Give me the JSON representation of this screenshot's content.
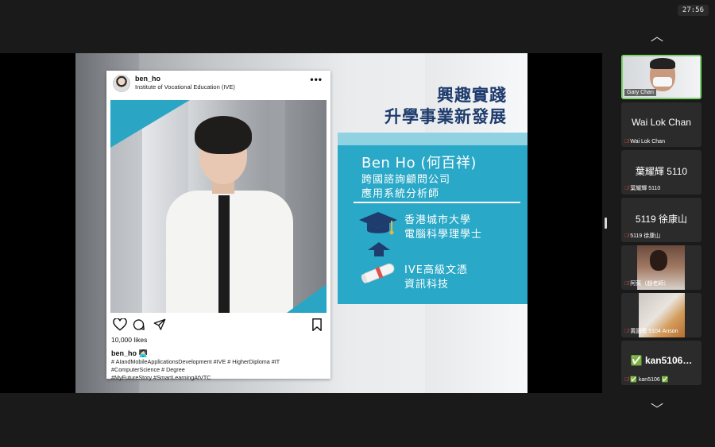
{
  "meeting": {
    "timer": "27:56"
  },
  "slide": {
    "headline": [
      "興趣實踐",
      "升學事業新發展"
    ],
    "profile": {
      "name": "Ben Ho (何百祥)",
      "role_lines": [
        "跨國諮詢顧問公司",
        "應用系統分析師"
      ],
      "education": [
        {
          "icon": "graduation-cap-icon",
          "lines": [
            "香港城市大學",
            "電腦科學理學士"
          ]
        },
        {
          "icon": "up-arrow-icon",
          "lines": []
        },
        {
          "icon": "diploma-scroll-icon",
          "lines": [
            "IVE高級文憑",
            "資訊科技"
          ]
        }
      ],
      "accent": "#2aa8c7",
      "headline_color": "#1f3c6e"
    },
    "instagram": {
      "username": "ben_ho",
      "subtitle": "Institute of Vocational Education (IVE)",
      "more": "•••",
      "likes": "10,000 likes",
      "caption_user": "ben_ho 🧑🏻‍💻",
      "caption_lines": [
        "# AIandMobileApplicationsDevelopment #IVE # HigherDiploma #IT",
        "#ComputerScience # Degree",
        "#MyFutureStory #SmartLearningAtVTC"
      ]
    }
  },
  "gallery": {
    "up": "︿",
    "down": "﹀",
    "participants": [
      {
        "name": "Gary Chan",
        "has_video": true,
        "active": true,
        "muted": false
      },
      {
        "display": "Wai Lok Chan",
        "name": "Wai Lok Chan",
        "muted": true
      },
      {
        "display": "葉耀輝 5110",
        "name": "葉耀輝 5110",
        "muted": true
      },
      {
        "display": "5119 徐康山",
        "name": "5119 徐康山",
        "muted": true
      },
      {
        "name": "阿蕉（趙老師）",
        "has_video": true,
        "muted": true
      },
      {
        "name": "黃國聰 5104 Anson",
        "has_video": true,
        "muted": true
      },
      {
        "display": "✅ kan5106…",
        "name": "✅ kan5106 ✅",
        "muted": true
      }
    ]
  }
}
